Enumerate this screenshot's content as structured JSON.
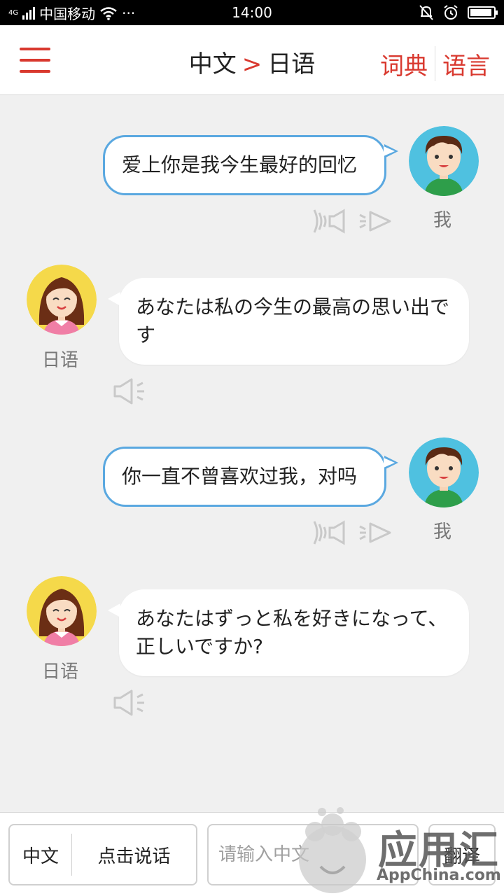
{
  "status_bar": {
    "network": "4G",
    "carrier": "中国移动",
    "more": "···",
    "time": "14:00",
    "battery_level": 0.95
  },
  "header": {
    "source_lang": "中文",
    "arrow": ">",
    "target_lang": "日语",
    "dictionary_label": "词典",
    "language_label": "语言"
  },
  "messages": [
    {
      "sender": "me",
      "name": "我",
      "text": "爱上你是我今生最好的回忆"
    },
    {
      "sender": "them",
      "name": "日语",
      "text": "あなたは私の今生の最高の思い出です"
    },
    {
      "sender": "me",
      "name": "我",
      "text": "你一直不曾喜欢过我，对吗"
    },
    {
      "sender": "them",
      "name": "日语",
      "text": "あなたはずっと私を好きになって、正しいですか?"
    }
  ],
  "bottom_bar": {
    "lang_label": "中文",
    "speak_label": "点击说话",
    "input_placeholder": "请输入中文",
    "translate_label": "翻译"
  },
  "watermark": {
    "text": "应用汇",
    "sub": "AppChina.com"
  },
  "colors": {
    "accent": "#d9392f",
    "bubble_border": "#5aa8e0",
    "background": "#f0f0f0"
  }
}
